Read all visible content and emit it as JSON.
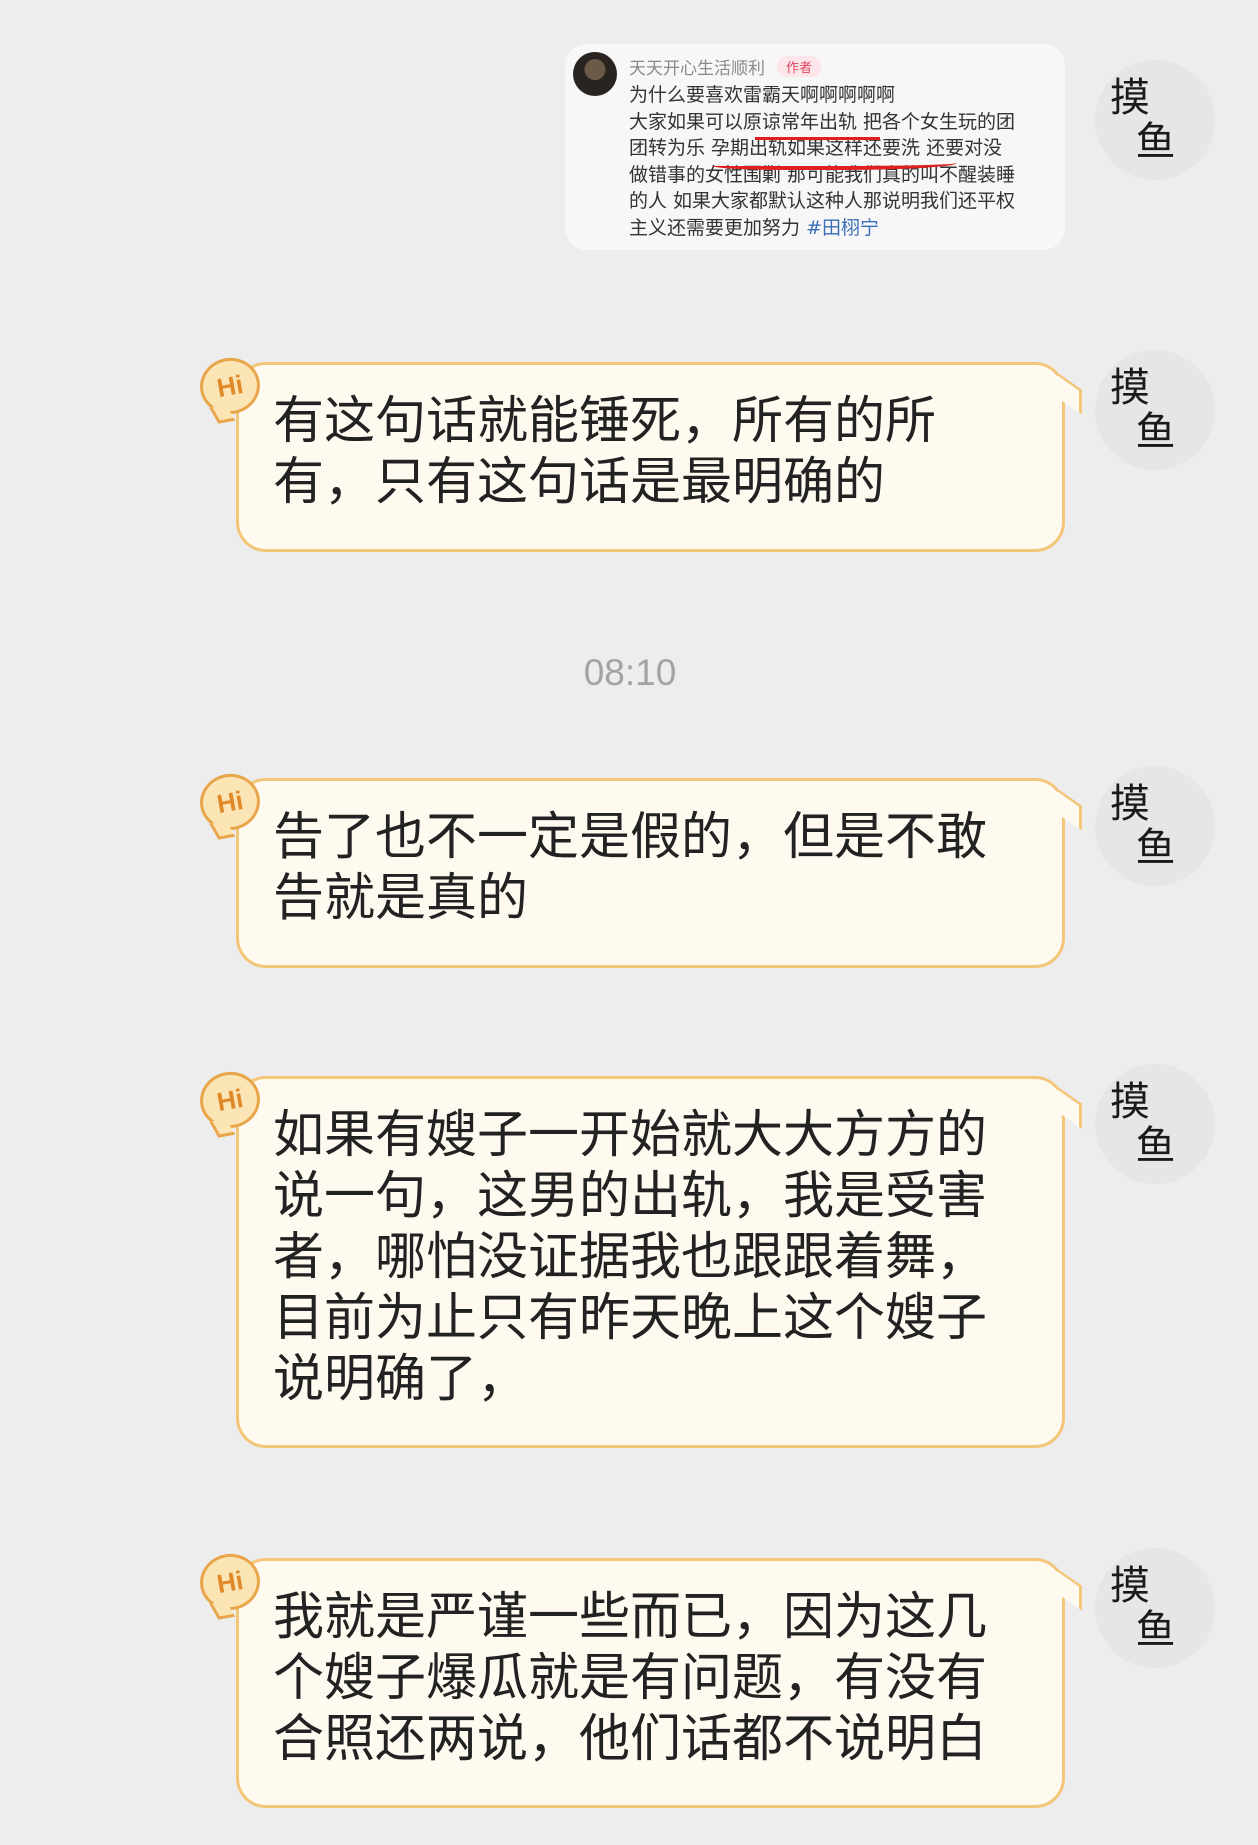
{
  "quoted_post": {
    "username": "天天开心生活顺利",
    "author_tag": "作者",
    "lines": [
      "为什么要喜欢雷霸天啊啊啊啊啊",
      "大家如果可以原谅常年出轨 把各个女生玩的团",
      "团转为乐 孕期出轨如果这样还要洗 还要对没",
      "做错事的女性围剿 那可能我们真的叫不醒装睡",
      "的人 如果大家都默认这种人那说明我们还平权",
      "主义还需要更加努力"
    ],
    "hashtag": "#田栩宁"
  },
  "timestamp": "08:10",
  "messages": [
    {
      "badge": "Hi",
      "text": "有这句话就能锤死，所有的所\n有，只有这句话是最明确的"
    },
    {
      "badge": "Hi",
      "text": "告了也不一定是假的，但是不敢\n告就是真的"
    },
    {
      "badge": "Hi",
      "text": "如果有嫂子一开始就大大方方的\n说一句，这男的出轨，我是受害\n者，哪怕没证据我也跟跟着舞，\n目前为止只有昨天晚上这个嫂子\n说明确了，"
    },
    {
      "badge": "Hi",
      "text": "我就是严谨一些而已，因为这几\n个嫂子爆瓜就是有问题，有没有\n合照还两说，他们话都不说明白"
    }
  ],
  "avatar": {
    "glyph_top": "摸",
    "glyph_bottom": "鱼"
  }
}
